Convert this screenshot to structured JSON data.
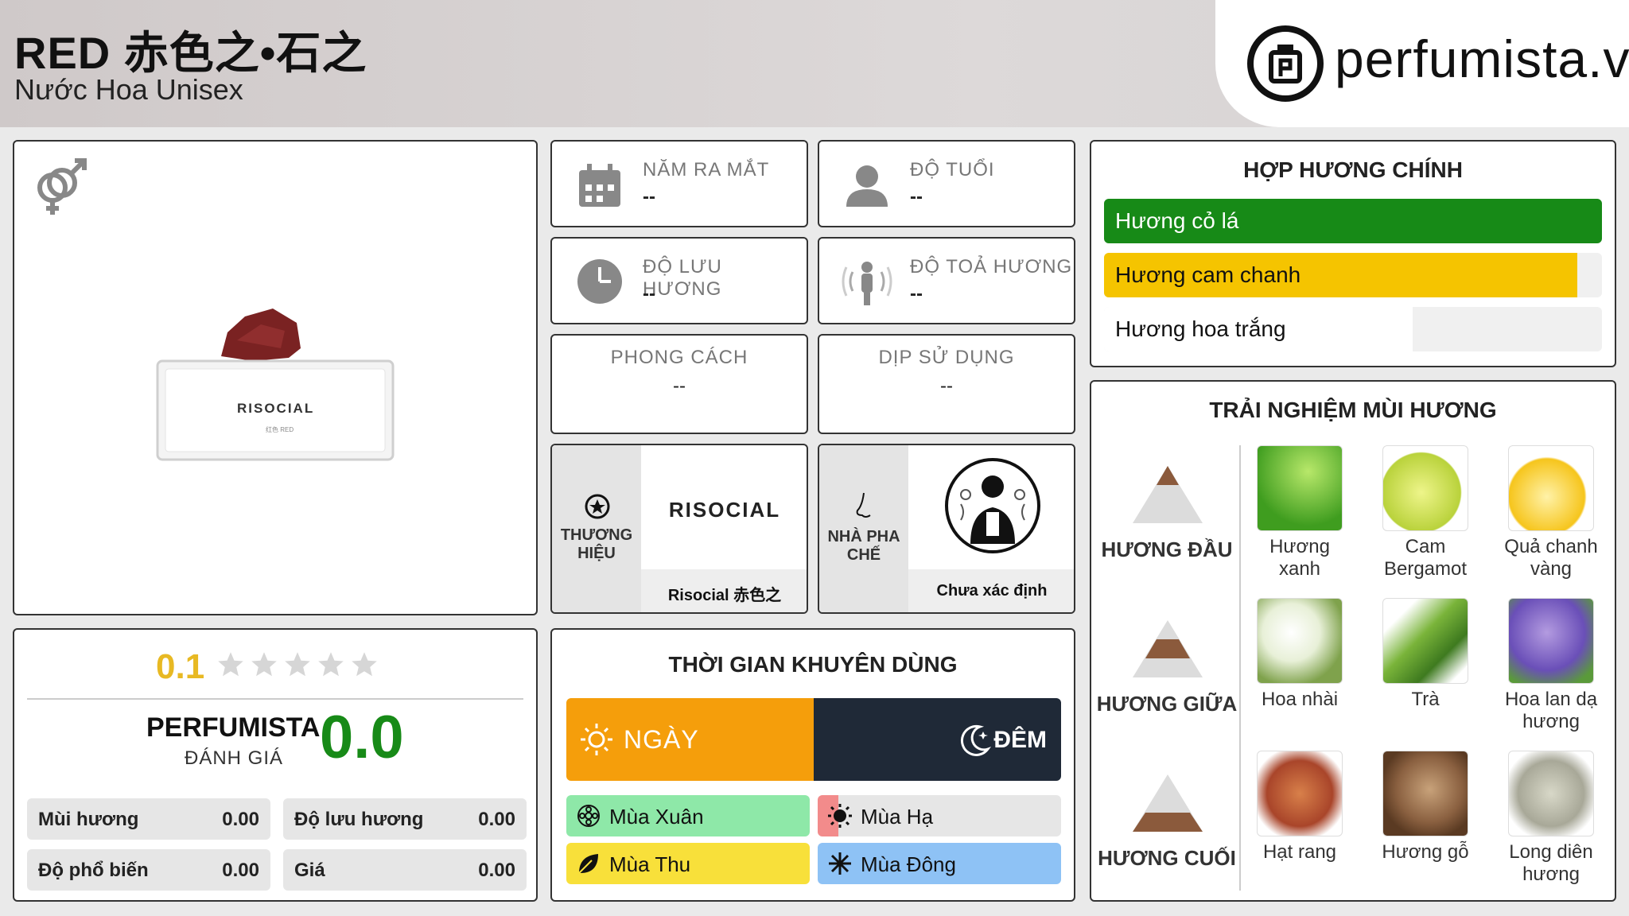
{
  "header": {
    "title": "RED 赤色之•石之",
    "subtitle": "Nước Hoa Unisex",
    "brand_site": "perfumista.vn"
  },
  "product": {
    "gender_icon": "unisex-gender-icon",
    "bottle_label": "RISOCIAL",
    "bottle_sublabel": "红色 RED"
  },
  "info": {
    "release_label": "NĂM RA MẮT",
    "release_value": "--",
    "age_label": "ĐỘ TUỔI",
    "age_value": "--",
    "longevity_label": "ĐỘ LƯU HƯƠNG",
    "longevity_value": "--",
    "sillage_label": "ĐỘ TOẢ HƯƠNG",
    "sillage_value": "--",
    "style_label": "PHONG CÁCH",
    "style_value": "--",
    "occasion_label": "DỊP SỬ DỤNG",
    "occasion_value": "--",
    "brand_label": "THƯƠNG HIỆU",
    "brand_logo_text": "RISOCIAL",
    "brand_name": "Risocial 赤色之",
    "perfumer_label": "NHÀ PHA CHẾ",
    "perfumer_name": "Chưa xác định"
  },
  "rating": {
    "user_score": "0.1",
    "stars": 5,
    "stars_filled": 0,
    "perfumista_label": "PERFUMISTA",
    "rating_label": "ĐÁNH GIÁ",
    "perfumista_score": "0.0",
    "criteria": [
      {
        "name": "Mùi hương",
        "value": "0.00"
      },
      {
        "name": "Độ lưu hương",
        "value": "0.00"
      },
      {
        "name": "Độ phổ biến",
        "value": "0.00"
      },
      {
        "name": "Giá",
        "value": "0.00"
      }
    ]
  },
  "usage_time": {
    "title": "THỜI GIAN KHUYÊN DÙNG",
    "day_label": "NGÀY",
    "night_label": "ĐÊM",
    "day_fraction": 0.5,
    "seasons": [
      {
        "name": "Mùa Xuân",
        "color": "#8ee8a8"
      },
      {
        "name": "Mùa Hạ",
        "color": "#e6e6e6",
        "accent": "#f28b8b"
      },
      {
        "name": "Mùa Thu",
        "color": "#f8e03a"
      },
      {
        "name": "Mùa Đông",
        "color": "#8ec2f5"
      }
    ],
    "colors": {
      "day": "#f59e0b",
      "night": "#1f2937"
    }
  },
  "accords": {
    "title": "HỢP HƯƠNG CHÍNH",
    "items": [
      {
        "name": "Hương cỏ lá",
        "level": 1.0,
        "color": "#178a17",
        "text_color": "#ffffff"
      },
      {
        "name": "Hương cam chanh",
        "level": 0.95,
        "color": "#f5c400",
        "text_color": "#111111"
      },
      {
        "name": "Hương hoa trắng",
        "level": 0.62,
        "color": "#ffffff",
        "text_color": "#111111"
      }
    ]
  },
  "notes": {
    "title": "TRẢI NGHIỆM MÙI HƯƠNG",
    "tiers": [
      {
        "label": "HƯƠNG ĐẦU",
        "items": [
          "Hương xanh",
          "Cam Bergamot",
          "Quả chanh vàng"
        ]
      },
      {
        "label": "HƯƠNG GIỮA",
        "items": [
          "Hoa nhài",
          "Trà",
          "Hoa lan dạ hương"
        ]
      },
      {
        "label": "HƯƠNG CUỐI",
        "items": [
          "Hạt rang",
          "Hương gỗ",
          "Long diên hương"
        ]
      }
    ]
  }
}
